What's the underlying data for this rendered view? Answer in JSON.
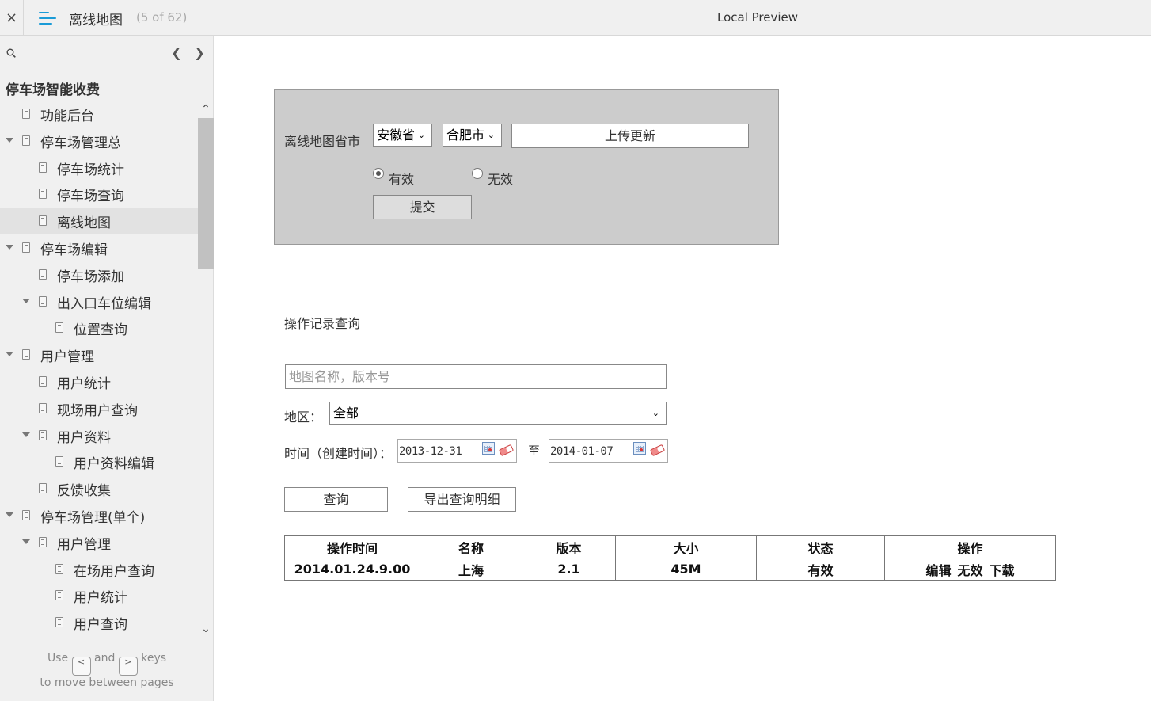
{
  "topbar": {
    "close": "×",
    "title": "离线地图",
    "count": "(5 of 62)",
    "preview": "Local Preview"
  },
  "sidebar": {
    "project": "停车场智能收费",
    "items": [
      {
        "label": "功能后台"
      },
      {
        "label": "停车场管理总"
      },
      {
        "label": "停车场统计"
      },
      {
        "label": "停车场查询"
      },
      {
        "label": "离线地图"
      },
      {
        "label": "停车场编辑"
      },
      {
        "label": "停车场添加"
      },
      {
        "label": "出入口车位编辑"
      },
      {
        "label": "位置查询"
      },
      {
        "label": "用户管理"
      },
      {
        "label": "用户统计"
      },
      {
        "label": "现场用户查询"
      },
      {
        "label": "用户资料"
      },
      {
        "label": "用户资料编辑"
      },
      {
        "label": "反馈收集"
      },
      {
        "label": "停车场管理(单个)"
      },
      {
        "label": "用户管理"
      },
      {
        "label": "在场用户查询"
      },
      {
        "label": "用户统计"
      },
      {
        "label": "用户查询"
      }
    ],
    "hint": {
      "use": "Use",
      "key_prev": "<",
      "and": "and",
      "key_next": ">",
      "keys": "keys",
      "line2": "to move between pages"
    }
  },
  "panel": {
    "label": "离线地图省市",
    "province": "安徽省",
    "city": "合肥市",
    "upload": "上传更新",
    "radio_valid": "有效",
    "radio_invalid": "无效",
    "submit": "提交"
  },
  "records": {
    "title": "操作记录查询",
    "search_placeholder": "地图名称，版本号",
    "region_label": "地区：",
    "region_value": "全部",
    "time_label": "时间（创建时间）：",
    "date_from": "2013-12-31",
    "to": "至",
    "date_to": "2014-01-07",
    "query": "查询",
    "export": "导出查询明细",
    "columns": [
      "操作时间",
      "名称",
      "版本",
      "大小",
      "状态",
      "操作"
    ],
    "rows": [
      {
        "time": "2014.01.24.9.00",
        "name": "上海",
        "version": "2.1",
        "size": "45M",
        "status": "有效",
        "ops": [
          "编辑",
          "无效",
          "下载"
        ]
      }
    ]
  },
  "colors": {
    "accent": "#1a9bd7",
    "panel_bg": "#cccccc",
    "sidebar_bg": "#f0f0f0"
  }
}
